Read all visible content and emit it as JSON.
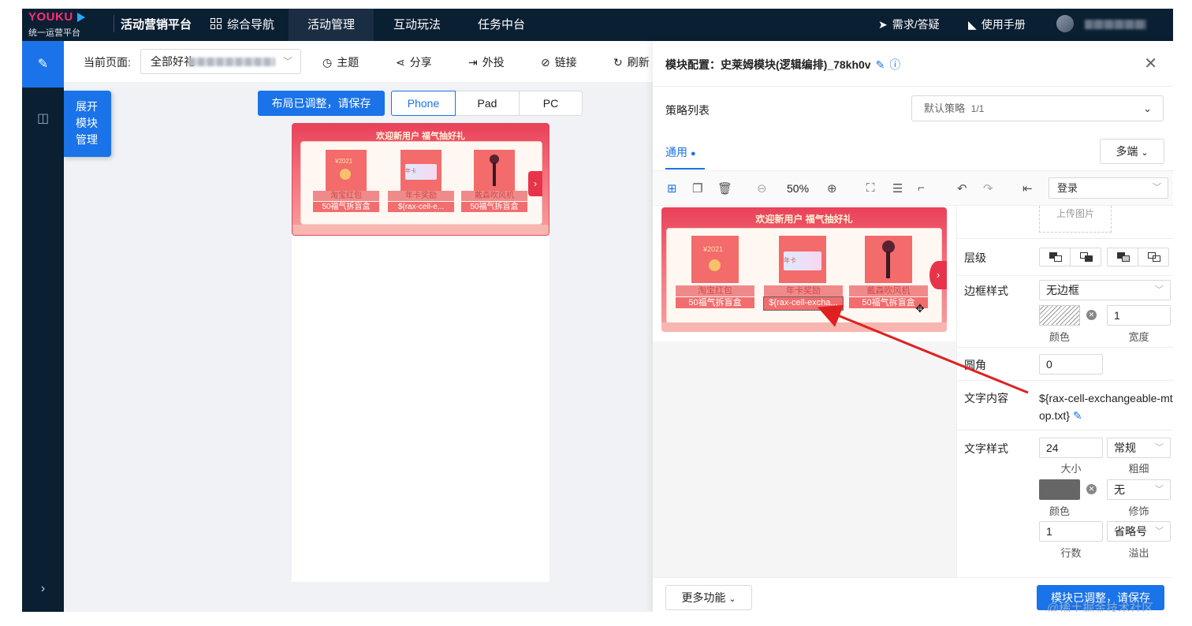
{
  "topbar": {
    "logo_brand": "YOUKU",
    "logo_sub": "统一运营平台",
    "platform": "活动营销平台",
    "nav": [
      "综合导航",
      "活动管理",
      "互动玩法",
      "任务中台"
    ],
    "help": "需求/答疑",
    "manual": "使用手册"
  },
  "sidebar": {
    "expand_lines": [
      "展开",
      "模块",
      "管理"
    ]
  },
  "pagebar": {
    "label": "当前页面:",
    "select_value": "全部好礼",
    "tools": [
      "主题",
      "分享",
      "外投",
      "链接",
      "刷新"
    ]
  },
  "preview": {
    "save_hint": "布局已调整，请保存",
    "devices": [
      "Phone",
      "Pad",
      "PC"
    ],
    "active_device": "Phone"
  },
  "banner": {
    "title": "欢迎新用户 福气抽好礼",
    "items": [
      {
        "name": "淘宝红包",
        "sub": "50福气拆盲盒",
        "img": "red-envelope-icon",
        "tag": "¥2021"
      },
      {
        "name": "年卡奖励",
        "sub": "${rax-cell-e...",
        "img": "card-icon",
        "tag": "年卡"
      },
      {
        "name": "戴森吹风机",
        "sub": "50福气拆盲盒",
        "img": "hair-dryer-icon",
        "tag": ""
      }
    ],
    "items_large_sub2": "${rax-cell-excha..."
  },
  "panel": {
    "title": "模块配置：史莱姆模块(逻辑编排)_78kh0v",
    "strategy_label": "策略列表",
    "strategy_value": "默认策略",
    "strategy_count": "1/1",
    "tab": "通用",
    "multi": "多端",
    "zoom": "50%",
    "login": "登录",
    "upload": "上传图片",
    "layer_label": "层级",
    "border_label": "边框样式",
    "border_value": "无边框",
    "border_width": "1",
    "color_label": "颜色",
    "width_label": "宽度",
    "radius_label": "圆角",
    "radius_value": "0",
    "text_content_label": "文字内容",
    "text_content_value": "${rax-cell-exchangeable-mtop.txt}",
    "text_style_label": "文字样式",
    "font_size": "24",
    "font_size_label": "大小",
    "weight_value": "常规",
    "weight_label": "粗细",
    "decoration_value": "无",
    "decoration_label": "修饰",
    "lines_value": "1",
    "lines_label": "行数",
    "overflow_value": "省略号",
    "overflow_label": "溢出",
    "more": "更多功能",
    "save": "模块已调整，请保存"
  },
  "watermark": "@稀土掘金技术社区",
  "colors": {
    "accent": "#1a73e8",
    "topbar": "#0b1f33",
    "annotation": "#e02020"
  }
}
